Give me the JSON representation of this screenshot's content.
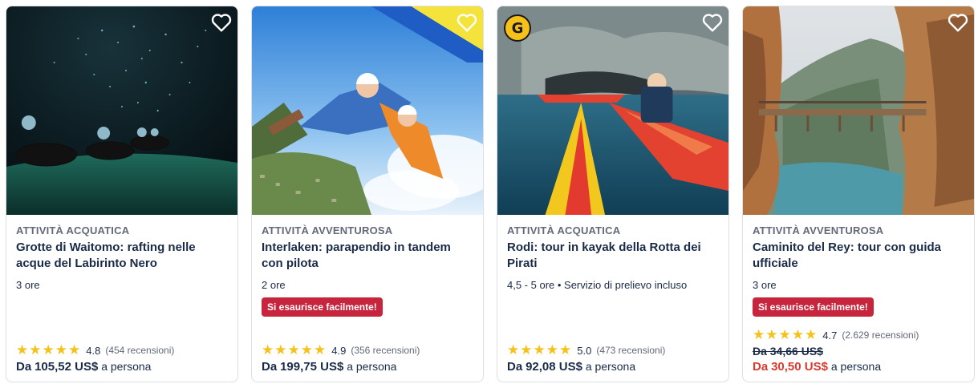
{
  "cards": [
    {
      "category": "ATTIVITÀ ACQUATICA",
      "title": "Grotte di Waitomo: rafting nelle acque del Labirinto Nero",
      "duration": "3 ore",
      "tag": "",
      "rating": "4.8",
      "reviews": "(454 recensioni)",
      "old_price": "",
      "price_prefix": "Da",
      "price": "105,52 US$",
      "price_suffix": "a persona",
      "image_icon": "cave-glowworms-image",
      "stars": 5
    },
    {
      "category": "ATTIVITÀ AVVENTUROSA",
      "title": "Interlaken: parapendio in tandem con pilota",
      "duration": "2 ore",
      "tag": "Si esaurisce facilmente!",
      "rating": "4.9",
      "reviews": "(356 recensioni)",
      "old_price": "",
      "price_prefix": "Da",
      "price": "199,75 US$",
      "price_suffix": "a persona",
      "image_icon": "paragliding-image",
      "stars": 5
    },
    {
      "category": "ATTIVITÀ ACQUATICA",
      "title": "Rodi: tour in kayak della Rotta dei Pirati",
      "duration": "4,5 - 5 ore • Servizio di prelievo incluso",
      "tag": "",
      "rating": "5.0",
      "reviews": "(473 recensioni)",
      "old_price": "",
      "price_prefix": "Da",
      "price": "92,08 US$",
      "price_suffix": "a persona",
      "image_icon": "kayak-image",
      "badge": "G",
      "stars": 5
    },
    {
      "category": "ATTIVITÀ AVVENTUROSA",
      "title": "Caminito del Rey: tour con guida ufficiale",
      "duration": "3 ore",
      "tag": "Si esaurisce facilmente!",
      "rating": "4.7",
      "reviews": "(2.629 recensioni)",
      "old_price": "Da 34,66 US$",
      "price_prefix": "Da",
      "price": "30,50 US$",
      "price_suffix": "a persona",
      "image_icon": "bridge-gorge-image",
      "stars": 5
    }
  ],
  "colors": {
    "accent_red": "#c7253e",
    "sale_red": "#dc3a2f",
    "star": "#f6c21a",
    "text": "#1a2b49",
    "muted": "#63687a"
  }
}
